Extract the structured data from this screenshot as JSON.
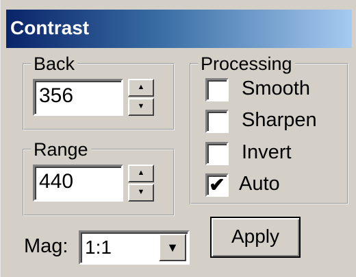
{
  "window": {
    "title": "Contrast"
  },
  "back": {
    "label": "Back",
    "value": "356",
    "up_icon": "spin-up-icon",
    "down_icon": "spin-down-icon"
  },
  "range": {
    "label": "Range",
    "value": "440",
    "up_icon": "spin-up-icon",
    "down_icon": "spin-down-icon"
  },
  "processing": {
    "label": "Processing",
    "options": [
      {
        "label": "Smooth",
        "checked": false
      },
      {
        "label": "Sharpen",
        "checked": false
      },
      {
        "label": "Invert",
        "checked": false
      },
      {
        "label": "Auto",
        "checked": true
      }
    ]
  },
  "mag": {
    "label": "Mag:",
    "value": "1:1",
    "arrow_icon": "dropdown-arrow-icon"
  },
  "apply": {
    "label": "Apply"
  },
  "colors": {
    "title_start": "#0a246a",
    "title_end": "#a6caf0",
    "face": "#d4d0c8"
  }
}
